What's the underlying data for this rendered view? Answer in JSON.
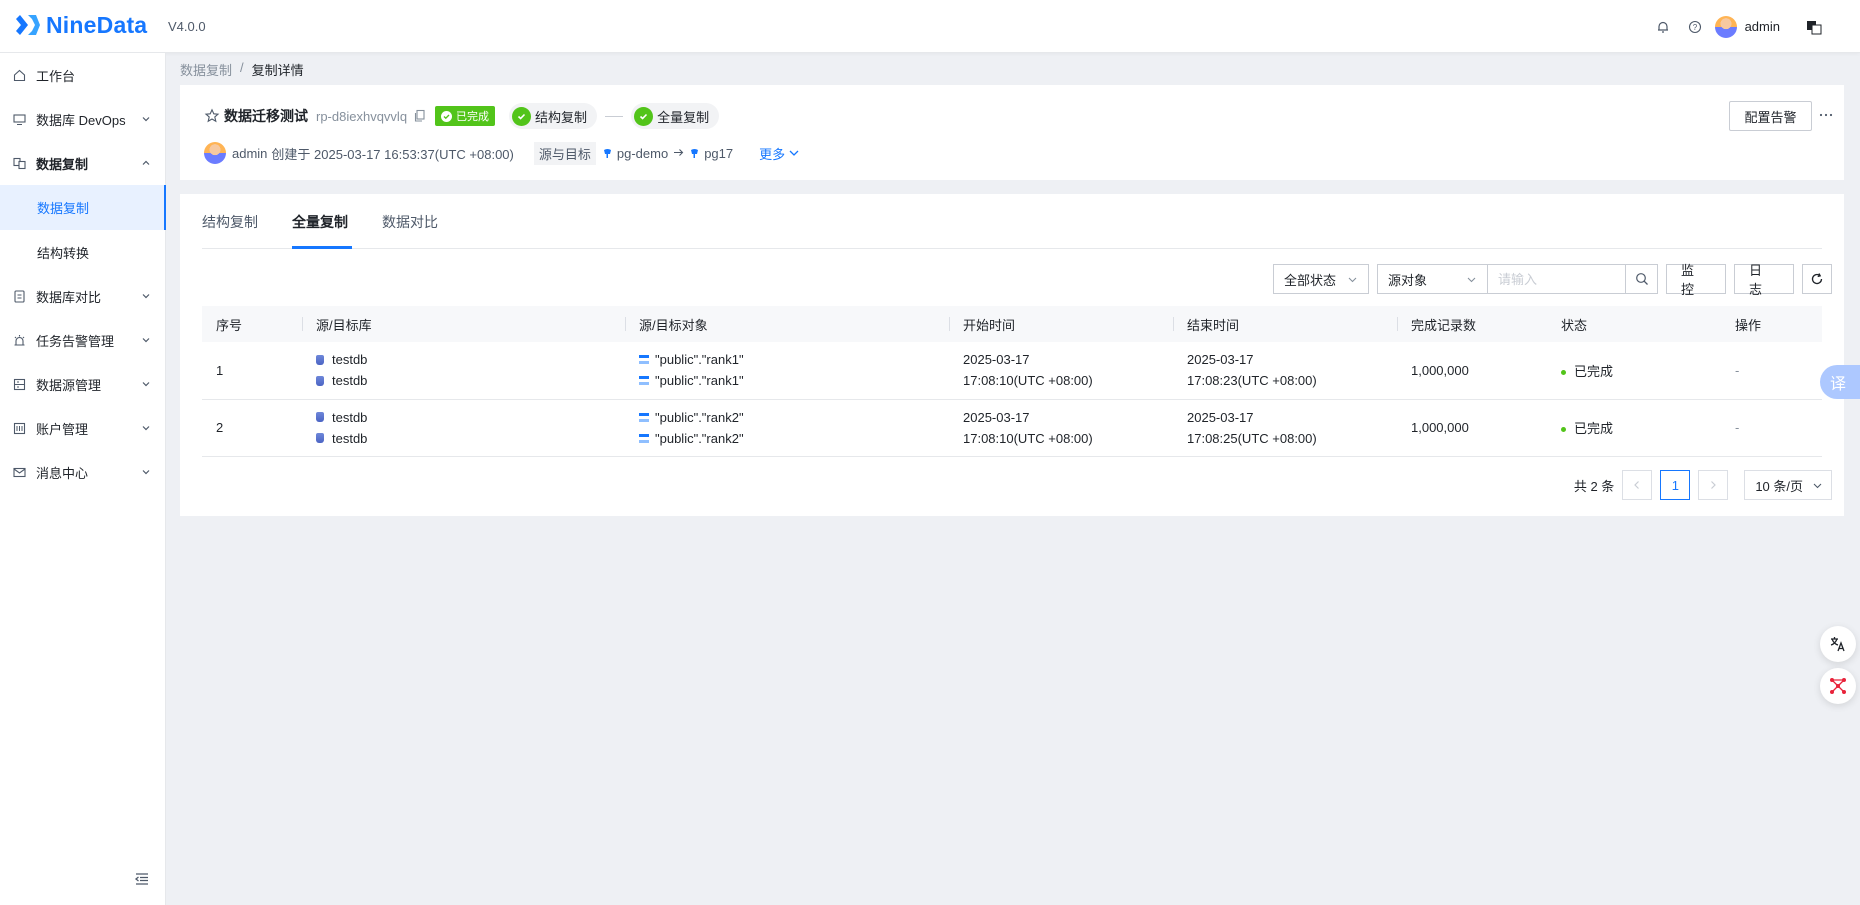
{
  "header": {
    "brand": "NineData",
    "version": "V4.0.0",
    "user": "admin",
    "brand_color": "#1677ff"
  },
  "sidebar": {
    "items": [
      {
        "label": "工作台",
        "icon": "home-icon"
      },
      {
        "label": "数据库 DevOps",
        "icon": "monitor-icon"
      },
      {
        "label": "数据复制",
        "icon": "replicate-icon"
      },
      {
        "label": "数据复制",
        "sub": true,
        "active": true
      },
      {
        "label": "结构转换",
        "sub": true
      },
      {
        "label": "数据库对比",
        "icon": "compare-icon"
      },
      {
        "label": "任务告警管理",
        "icon": "alarm-icon"
      },
      {
        "label": "数据源管理",
        "icon": "datasource-icon"
      },
      {
        "label": "账户管理",
        "icon": "account-icon"
      },
      {
        "label": "消息中心",
        "icon": "mail-icon"
      }
    ]
  },
  "breadcrumb": {
    "parent": "数据复制",
    "separator": "/",
    "current": "复制详情"
  },
  "task": {
    "name": "数据迁移测试",
    "id": "rp-d8iexhvqvvlq",
    "status": "已完成",
    "stage1": "结构复制",
    "stage2": "全量复制",
    "creator": "admin",
    "created_text": "创建于 2025-03-17 16:53:37(UTC +08:00)",
    "source_target_label": "源与目标",
    "source": "pg-demo",
    "target": "pg17",
    "more": "更多",
    "alert_button": "配置告警"
  },
  "tabs": [
    "结构复制",
    "全量复制",
    "数据对比"
  ],
  "active_tab": "全量复制",
  "filters": {
    "status": "全部状态",
    "object": "源对象",
    "search_placeholder": "请输入",
    "monitor": "监 控",
    "log": "日 志"
  },
  "table": {
    "columns": [
      "序号",
      "源/目标库",
      "源/目标对象",
      "开始时间",
      "结束时间",
      "完成记录数",
      "状态",
      "操作"
    ],
    "rows": [
      {
        "no": "1",
        "src_db": "testdb",
        "dst_db": "testdb",
        "src_obj": "\"public\".\"rank1\"",
        "dst_obj": "\"public\".\"rank1\"",
        "start_date": "2025-03-17",
        "start_time": "17:08:10(UTC +08:00)",
        "end_date": "2025-03-17",
        "end_time": "17:08:23(UTC +08:00)",
        "records": "1,000,000",
        "status": "已完成",
        "action": "-"
      },
      {
        "no": "2",
        "src_db": "testdb",
        "dst_db": "testdb",
        "src_obj": "\"public\".\"rank2\"",
        "dst_obj": "\"public\".\"rank2\"",
        "start_date": "2025-03-17",
        "start_time": "17:08:10(UTC +08:00)",
        "end_date": "2025-03-17",
        "end_time": "17:08:25(UTC +08:00)",
        "records": "1,000,000",
        "status": "已完成",
        "action": "-"
      }
    ]
  },
  "pagination": {
    "total": "共 2 条",
    "current_page": "1",
    "page_size": "10 条/页"
  },
  "floating": {
    "translate_tab": "译"
  },
  "colors": {
    "success": "#52c41a",
    "primary": "#1677ff"
  }
}
